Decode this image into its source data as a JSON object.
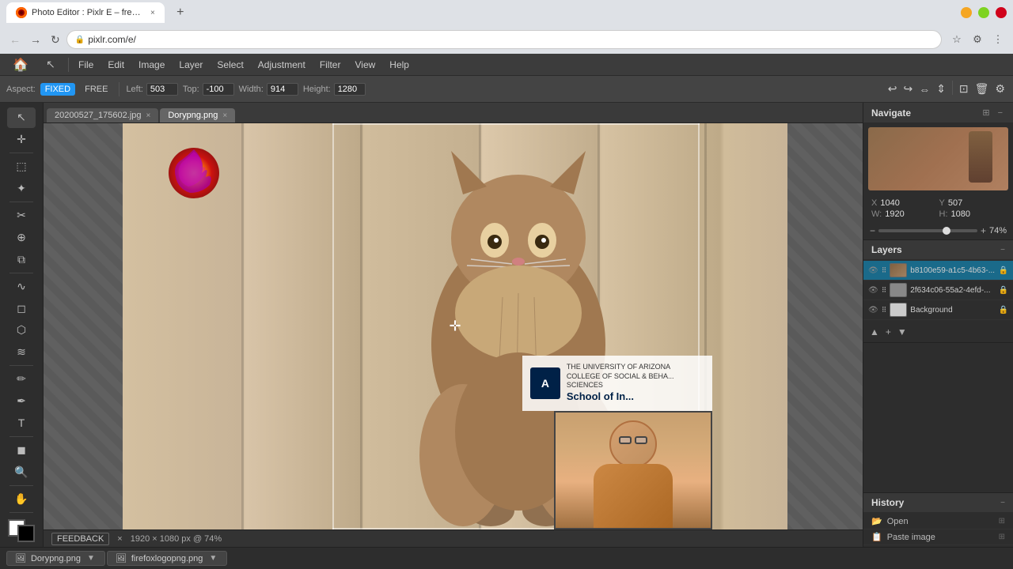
{
  "browser": {
    "tab1": {
      "label": "Photo Editor : Pixlr E – free imag...",
      "favicon": "🦊",
      "url": "pixlr.com/e/"
    },
    "new_tab_label": "+",
    "win_controls": [
      "−",
      "□",
      "×"
    ]
  },
  "menubar": {
    "logo_text": "🏠",
    "items": [
      "File",
      "Edit",
      "Image",
      "Layer",
      "Select",
      "Adjustment",
      "Filter",
      "View",
      "Help"
    ]
  },
  "toolbar": {
    "aspect_label": "Aspect:",
    "aspect_fixed": "FIXED",
    "aspect_free": "FREE",
    "left_label": "Left:",
    "left_value": "503",
    "top_label": "Top:",
    "top_value": "-100",
    "width_label": "Width:",
    "width_value": "914",
    "height_label": "Height:",
    "height_value": "1280"
  },
  "canvas_tabs": [
    {
      "label": "20200527_175602.jpg",
      "active": false
    },
    {
      "label": "Dorypng.png",
      "active": true
    }
  ],
  "navigate": {
    "title": "Navigate",
    "x_label": "X",
    "x_value": "1040",
    "y_label": "Y",
    "y_value": "507",
    "w_label": "W:",
    "w_value": "1920",
    "h_label": "H:",
    "h_value": "1080",
    "zoom_value": "74%"
  },
  "layers": {
    "title": "Layers",
    "items": [
      {
        "name": "b8100e59-a1c5-4b63-...",
        "active": true,
        "has_cat": true
      },
      {
        "name": "2f634c06-55a2-4efd-...",
        "active": false,
        "has_cat": false
      },
      {
        "name": "Background",
        "active": false,
        "is_bg": true
      }
    ]
  },
  "history": {
    "title": "History",
    "items": [
      {
        "label": "Open",
        "icon": "📂"
      },
      {
        "label": "Paste image",
        "icon": "📋"
      }
    ]
  },
  "taskbar": {
    "items": [
      {
        "label": "Dorypng.png"
      },
      {
        "label": "firefoxlogopng.png"
      }
    ]
  },
  "status": {
    "feedback_label": "FEEDBACK",
    "close_label": "×",
    "size_label": "1920 × 1080 px @ 74%"
  },
  "university": {
    "logo_text": "A",
    "line1": "THE UNIVERSITY OF ARIZONA",
    "line2": "COLLEGE OF SOCIAL & BEHA... SCIENCES",
    "main": "School of In..."
  }
}
